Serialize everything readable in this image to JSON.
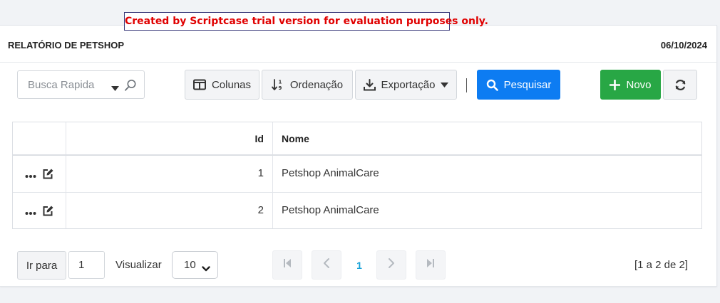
{
  "banner": "Created by Scriptcase trial version for evaluation purposes only.",
  "header": {
    "title": "RELATÓRIO DE PETSHOP",
    "date": "06/10/2024"
  },
  "toolbar": {
    "search_placeholder": "Busca Rapida",
    "columns_label": "Colunas",
    "sort_label": "Ordenação",
    "export_label": "Exportação",
    "search_button_label": "Pesquisar",
    "new_button_label": "Novo"
  },
  "table": {
    "columns": [
      "Id",
      "Nome"
    ],
    "rows": [
      {
        "id": "1",
        "nome": "Petshop AnimalCare"
      },
      {
        "id": "2",
        "nome": "Petshop AnimalCare"
      }
    ]
  },
  "pager": {
    "goto_label": "Ir para",
    "goto_value": "1",
    "view_label": "Visualizar",
    "per_page": "10",
    "current_page": "1",
    "range_text": "[1 a 2 de 2]"
  },
  "colors": {
    "primary": "#0d7cf2",
    "success": "#28a745",
    "banner_text": "#e00000",
    "page_active": "#17a2d8"
  }
}
